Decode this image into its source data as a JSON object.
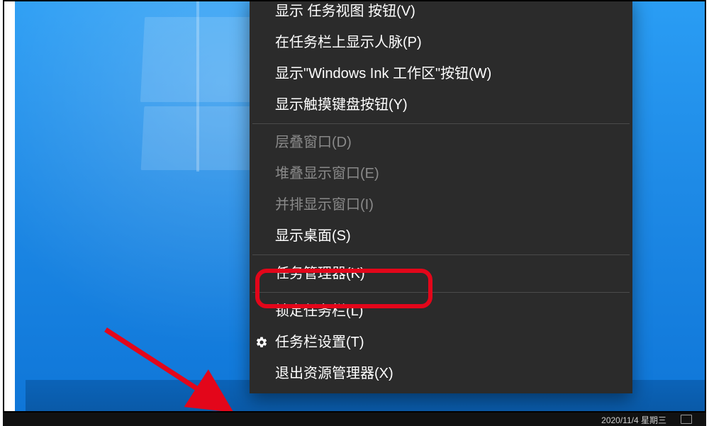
{
  "meta": {
    "domain": "Computer-Use",
    "description": "Windows 10 taskbar right-click context menu (Chinese)"
  },
  "context_menu": {
    "items": [
      {
        "id": "show-task-view",
        "label": "显示 任务视图 按钮(V)",
        "enabled": true,
        "type": "item"
      },
      {
        "id": "show-people",
        "label": "在任务栏上显示人脉(P)",
        "enabled": true,
        "type": "item"
      },
      {
        "id": "show-ink-workspace",
        "label": "显示\"Windows Ink 工作区\"按钮(W)",
        "enabled": true,
        "type": "item"
      },
      {
        "id": "show-touch-keyboard",
        "label": "显示触摸键盘按钮(Y)",
        "enabled": true,
        "type": "item"
      },
      {
        "type": "separator"
      },
      {
        "id": "cascade-windows",
        "label": "层叠窗口(D)",
        "enabled": false,
        "type": "item"
      },
      {
        "id": "stack-windows",
        "label": "堆叠显示窗口(E)",
        "enabled": false,
        "type": "item"
      },
      {
        "id": "side-by-side-windows",
        "label": "并排显示窗口(I)",
        "enabled": false,
        "type": "item"
      },
      {
        "id": "show-desktop",
        "label": "显示桌面(S)",
        "enabled": true,
        "type": "item"
      },
      {
        "type": "separator"
      },
      {
        "id": "task-manager",
        "label": "任务管理器(K)",
        "enabled": true,
        "type": "item",
        "highlighted": true
      },
      {
        "type": "separator"
      },
      {
        "id": "lock-taskbar",
        "label": "锁定任务栏(L)",
        "enabled": true,
        "type": "item"
      },
      {
        "id": "taskbar-settings",
        "label": "任务栏设置(T)",
        "enabled": true,
        "type": "item",
        "icon": "gear"
      },
      {
        "id": "exit-explorer",
        "label": "退出资源管理器(X)",
        "enabled": true,
        "type": "item"
      }
    ]
  },
  "annotation": {
    "highlight_target": "task-manager",
    "highlight_color": "#e3061a",
    "arrow_color": "#e3061a"
  },
  "system_tray": {
    "date": "2020/11/4 星期三"
  }
}
